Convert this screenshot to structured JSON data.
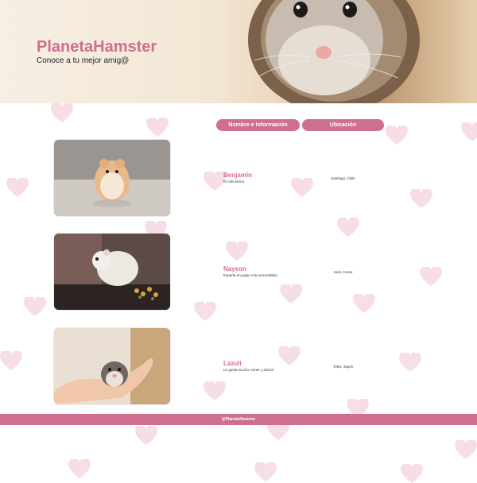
{
  "hero": {
    "title": "PlanetaHamster",
    "tagline": "Conoce a tu mejor amig@"
  },
  "table": {
    "headers": [
      "Nombre e Información",
      "Ubicación"
    ],
    "rows": [
      {
        "name": "Benjamín",
        "description": "El más tierno",
        "location": "Santiago, Chile"
      },
      {
        "name": "Nayeon",
        "description": "Experta en jugar a las escondidas",
        "location": "Seúl, Corea"
      },
      {
        "name": "Lazuli",
        "description": "Le gusta mucho comer y dormir",
        "location": "Tokio, Japón"
      }
    ]
  },
  "footer": {
    "text": "@PlanetaHamster"
  },
  "colors": {
    "brand": "#cf6f8e",
    "header_button": "#cd6f8d",
    "hearts": "#f7dde5"
  },
  "icons": [
    "heart-icon"
  ]
}
